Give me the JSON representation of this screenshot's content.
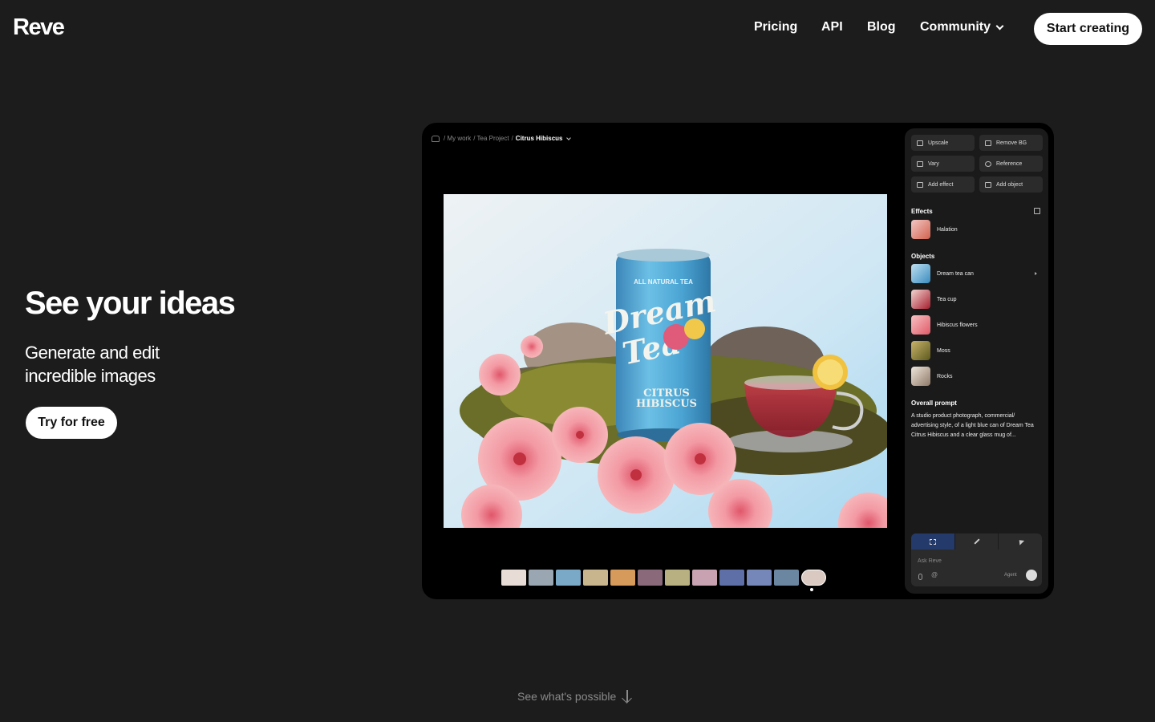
{
  "nav": {
    "logo": "Reve",
    "links": [
      "Pricing",
      "API",
      "Blog",
      "Community"
    ],
    "cta": "Start creating"
  },
  "hero": {
    "title": "See your ideas",
    "subtitle_line1": "Generate and edit",
    "subtitle_line2": "incredible images",
    "cta": "Try for free"
  },
  "footer_hint": "See what's possible",
  "app": {
    "breadcrumb": [
      "/ My work",
      "/ Tea Project",
      "/",
      "Citrus Hibiscus"
    ],
    "product_image": {
      "can_top": "ALL NATURAL TEA",
      "brand_line1": "Dream",
      "brand_line2": "Tea",
      "flavor_line1": "CITRUS",
      "flavor_line2": "HIBISCUS"
    },
    "tools": [
      "Upscale",
      "Remove BG",
      "Vary",
      "Reference",
      "Add effect",
      "Add object"
    ],
    "effects_heading": "Effects",
    "effects": [
      "Halation"
    ],
    "objects_heading": "Objects",
    "objects": [
      "Dream tea can",
      "Tea cup",
      "Hibiscus flowers",
      "Moss",
      "Rocks"
    ],
    "prompt_heading": "Overall prompt",
    "prompt_text": "A studio product photograph, commercial/ advertising style, of a light blue can of Dream Tea Citrus Hibiscus and a clear glass mug of...",
    "ask_placeholder": "Ask Reve",
    "agent_label": "Agent",
    "thumb_colors": [
      "#e8dcd6",
      "#9aa7b3",
      "#7aa9c8",
      "#c9b58d",
      "#d69a5a",
      "#8a6a7a",
      "#b9b081",
      "#c8a2b0",
      "#5e6fa8",
      "#7586b8",
      "#6b86a0",
      "#d9c9c0"
    ]
  },
  "colors": {
    "background": "#1c1c1c",
    "panel": "#1a1a1a",
    "accent": "#243a6b"
  }
}
